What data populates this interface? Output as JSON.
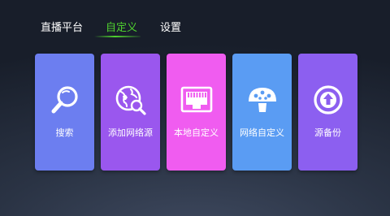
{
  "nav": {
    "tabs": [
      {
        "label": "直播平台"
      },
      {
        "label": "自定义"
      },
      {
        "label": "设置"
      }
    ],
    "active_index": 1,
    "active_color": "#4fd12f"
  },
  "cards": [
    {
      "label": "搜索",
      "icon": "search-icon",
      "color": "#6c7ef0"
    },
    {
      "label": "添加网络源",
      "icon": "globe-search-icon",
      "color": "#9a57ee"
    },
    {
      "label": "本地自定义",
      "icon": "ethernet-port-icon",
      "color": "#f05cf0"
    },
    {
      "label": "网络自定义",
      "icon": "mushroom-icon",
      "color": "#5a9cf3"
    },
    {
      "label": "源备份",
      "icon": "upload-circle-icon",
      "color": "#8c5ff0"
    }
  ]
}
